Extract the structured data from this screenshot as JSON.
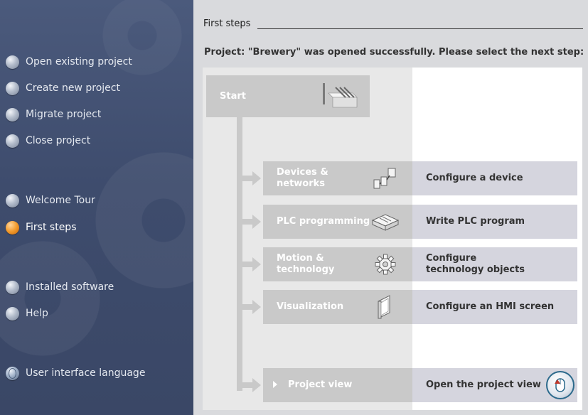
{
  "sidebar": {
    "items": [
      {
        "label": "Open existing project",
        "icon": "bullet-icon"
      },
      {
        "label": "Create new project",
        "icon": "bullet-icon"
      },
      {
        "label": "Migrate project",
        "icon": "bullet-icon"
      },
      {
        "label": "Close project",
        "icon": "bullet-icon"
      },
      {
        "label": "Welcome Tour",
        "icon": "bullet-icon"
      },
      {
        "label": "First steps",
        "icon": "bullet-active-icon",
        "active": true
      },
      {
        "label": "Installed software",
        "icon": "bullet-icon"
      },
      {
        "label": "Help",
        "icon": "bullet-icon"
      },
      {
        "label": "User interface language",
        "icon": "globe-icon"
      }
    ]
  },
  "content": {
    "title": "First steps",
    "message": "Project: \"Brewery\" was opened successfully. Please select the next step:",
    "start_label": "Start",
    "steps": [
      {
        "label_line1": "Devices &",
        "label_line2": "networks",
        "desc_line1": "Configure a device",
        "desc_line2": "",
        "icon": "devices-networks-icon"
      },
      {
        "label_line1": "PLC programming",
        "label_line2": "",
        "desc_line1": "Write PLC program",
        "desc_line2": "",
        "icon": "plc-program-icon"
      },
      {
        "label_line1": "Motion &",
        "label_line2": "technology",
        "desc_line1": "Configure",
        "desc_line2": "technology objects",
        "icon": "gear-icon"
      },
      {
        "label_line1": "Visualization",
        "label_line2": "",
        "desc_line1": "Configure an HMI screen",
        "desc_line2": "",
        "icon": "hmi-screen-icon"
      },
      {
        "label_line1": "Project view",
        "label_line2": "",
        "desc_line1": "Open the project view",
        "desc_line2": "",
        "icon": "chevron-right-icon"
      }
    ]
  },
  "colors": {
    "sidebar_bg": "#3e4c6d",
    "active_bullet": "#f29a2c",
    "step_gray": "#c9c9c9",
    "step_desc_bg": "#d5d5de"
  }
}
